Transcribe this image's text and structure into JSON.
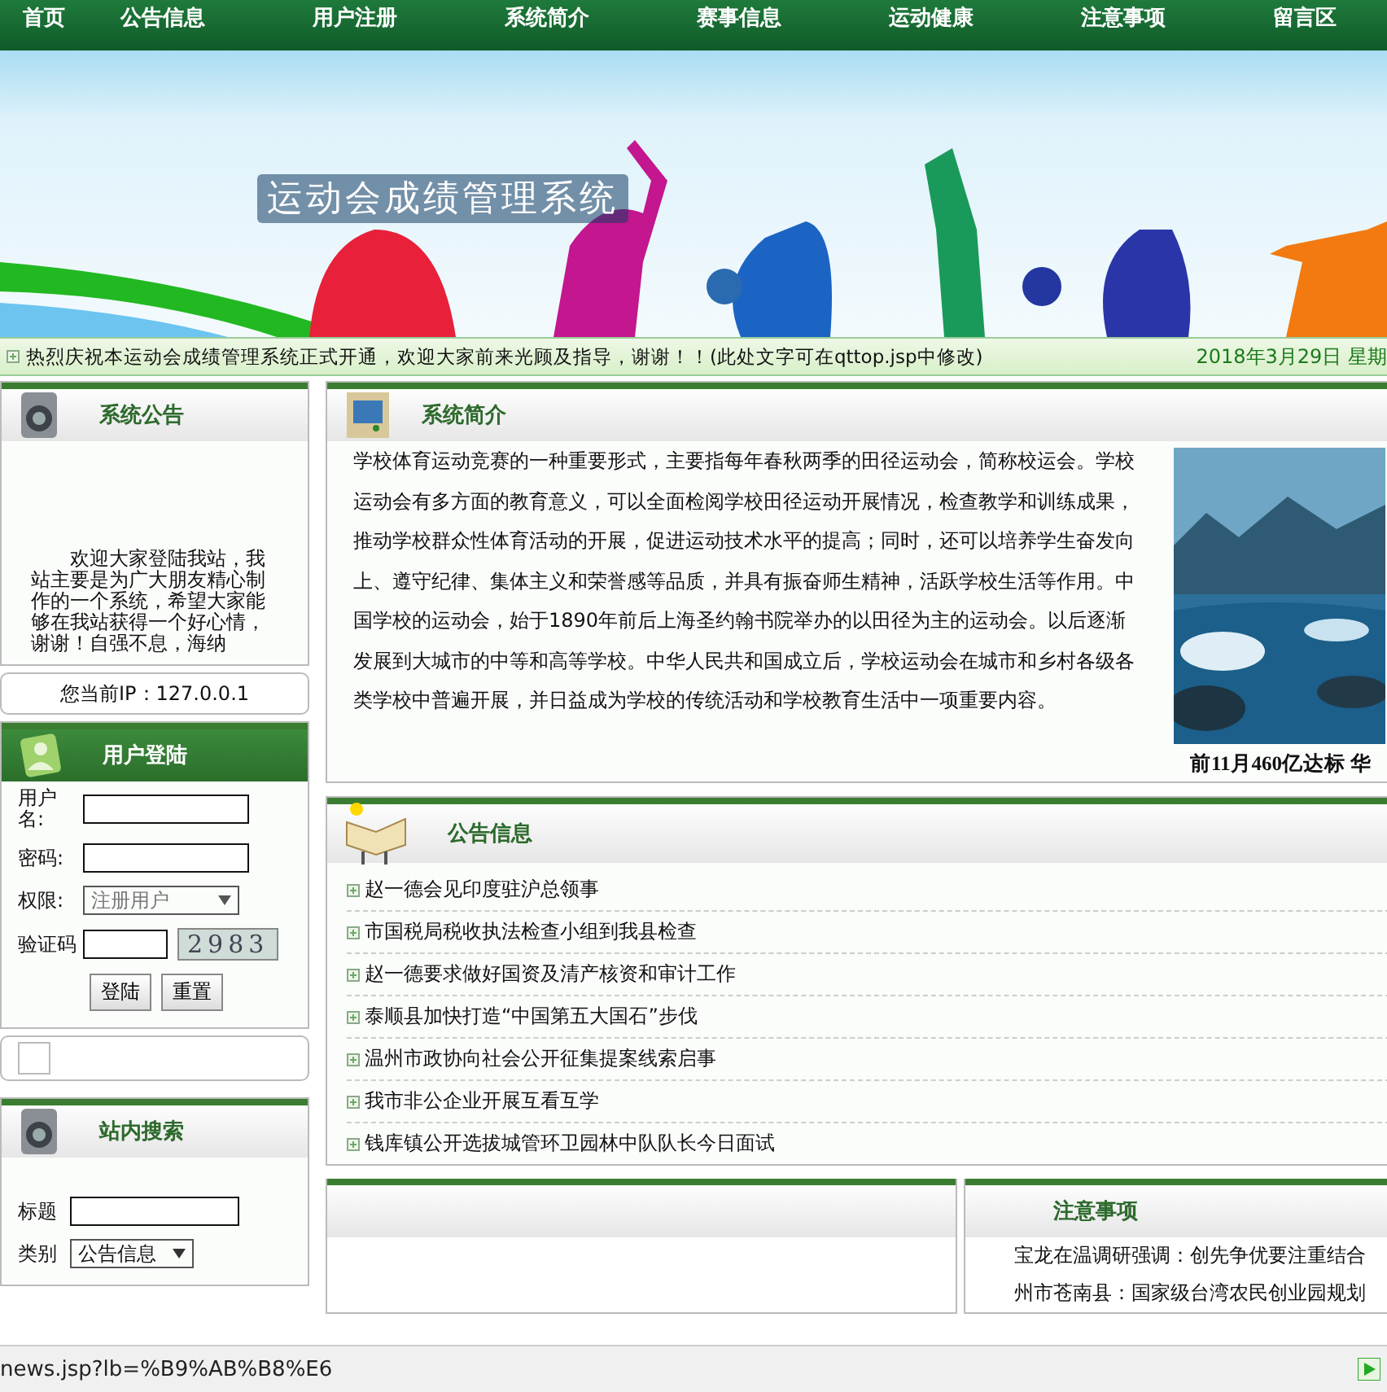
{
  "nav": [
    {
      "label": "首页"
    },
    {
      "label": "公告信息"
    },
    {
      "label": "用户注册"
    },
    {
      "label": "系统简介"
    },
    {
      "label": "赛事信息"
    },
    {
      "label": "运动健康"
    },
    {
      "label": "注意事项"
    },
    {
      "label": "留言区"
    }
  ],
  "banner": {
    "title": "运动会成绩管理系统"
  },
  "ticker": {
    "message": "热烈庆祝本运动会成绩管理系统正式开通，欢迎大家前来光顾及指导，谢谢！！(此处文字可在qttop.jsp中修改)",
    "date": "2018年3月29日 星期"
  },
  "notice": {
    "title": "系统公告",
    "text": "欢迎大家登陆我站，我站主要是为广大朋友精心制作的一个系统，希望大家能够在我站获得一个好心情，谢谢！自强不息，海纳"
  },
  "ip": {
    "text": "您当前IP：127.0.0.1"
  },
  "login": {
    "title": "用户登陆",
    "fields": [
      {
        "kind": "text",
        "label": "用户名:"
      },
      {
        "kind": "password",
        "label": "密码:"
      },
      {
        "kind": "select",
        "label": "权限:",
        "value": "注册用户"
      },
      {
        "kind": "captcha",
        "label": "验证码",
        "code": "2983"
      }
    ],
    "buttons": [
      "登陆",
      "重置"
    ]
  },
  "search": {
    "title": "站内搜索",
    "fields": [
      {
        "kind": "text",
        "label": "标题"
      },
      {
        "kind": "select",
        "label": "类别",
        "value": "公告信息"
      }
    ]
  },
  "intro": {
    "title": "系统简介",
    "text": "学校体育运动竞赛的一种重要形式，主要指每年春秋两季的田径运动会，简称校运会。学校运动会有多方面的教育意义，可以全面检阅学校田径运动开展情况，检查教学和训练成果，推动学校群众性体育活动的开展，促进运动技术水平的提高；同时，还可以培养学生奋发向上、遵守纪律、集体主义和荣誉感等品质，并具有振奋师生精神，活跃学校生活等作用。中国学校的运动会，始于1890年前后上海圣约翰书院举办的以田径为主的运动会。以后逐渐发展到大城市的中等和高等学校。中华人民共和国成立后，学校运动会在城市和乡村各级各类学校中普遍开展，并日益成为学校的传统活动和学校教育生活中一项重要内容。",
    "photo_caption": "前11月460亿达标 华"
  },
  "announcements": {
    "title": "公告信息",
    "items": [
      "赵一德会见印度驻沪总领事",
      "市国税局税收执法检查小组到我县检查",
      "赵一德要求做好国资及清产核资和审计工作",
      "泰顺县加快打造“中国第五大国石”步伐",
      "温州市政协向社会公开征集提案线索启事",
      "我市非公企业开展互看互学",
      "钱库镇公开选拔城管环卫园林中队队长今日面试"
    ]
  },
  "notes": {
    "title": "注意事项",
    "items": [
      "宝龙在温调研强调：创先争优要注重结合",
      "州市苍南县：国家级台湾农民创业园规划"
    ]
  },
  "status_bar": {
    "url": "news.jsp?lb=%B9%AB%B8%E6"
  }
}
